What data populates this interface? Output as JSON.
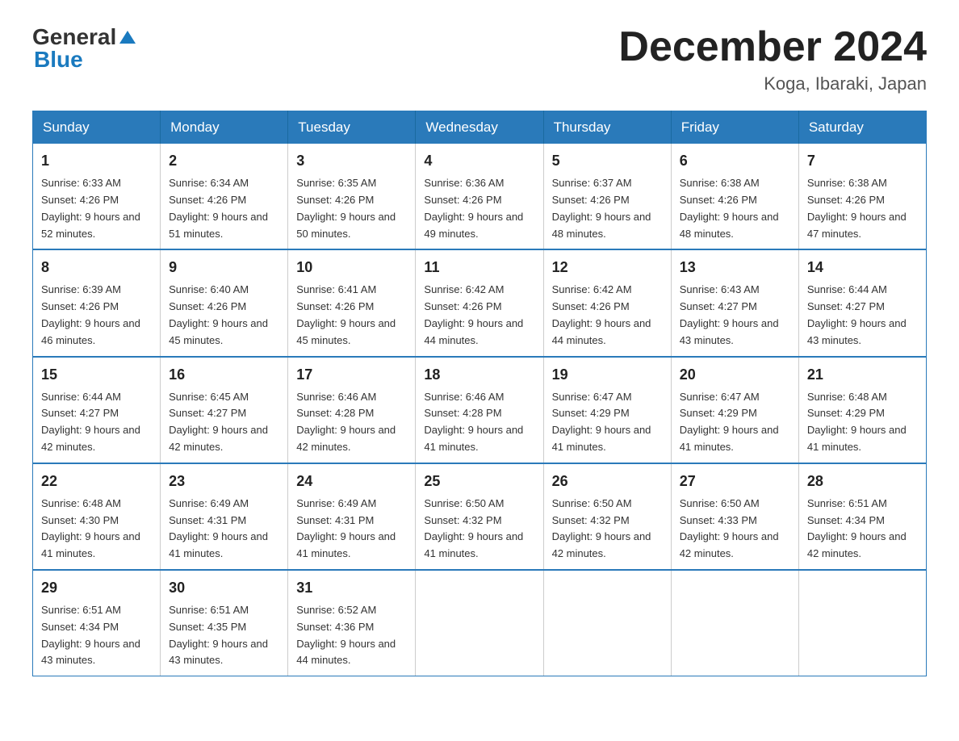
{
  "header": {
    "logo_text1": "General",
    "logo_text2": "Blue",
    "month_title": "December 2024",
    "location": "Koga, Ibaraki, Japan"
  },
  "days_of_week": [
    "Sunday",
    "Monday",
    "Tuesday",
    "Wednesday",
    "Thursday",
    "Friday",
    "Saturday"
  ],
  "weeks": [
    [
      {
        "day": "1",
        "sunrise": "6:33 AM",
        "sunset": "4:26 PM",
        "daylight": "9 hours and 52 minutes."
      },
      {
        "day": "2",
        "sunrise": "6:34 AM",
        "sunset": "4:26 PM",
        "daylight": "9 hours and 51 minutes."
      },
      {
        "day": "3",
        "sunrise": "6:35 AM",
        "sunset": "4:26 PM",
        "daylight": "9 hours and 50 minutes."
      },
      {
        "day": "4",
        "sunrise": "6:36 AM",
        "sunset": "4:26 PM",
        "daylight": "9 hours and 49 minutes."
      },
      {
        "day": "5",
        "sunrise": "6:37 AM",
        "sunset": "4:26 PM",
        "daylight": "9 hours and 48 minutes."
      },
      {
        "day": "6",
        "sunrise": "6:38 AM",
        "sunset": "4:26 PM",
        "daylight": "9 hours and 48 minutes."
      },
      {
        "day": "7",
        "sunrise": "6:38 AM",
        "sunset": "4:26 PM",
        "daylight": "9 hours and 47 minutes."
      }
    ],
    [
      {
        "day": "8",
        "sunrise": "6:39 AM",
        "sunset": "4:26 PM",
        "daylight": "9 hours and 46 minutes."
      },
      {
        "day": "9",
        "sunrise": "6:40 AM",
        "sunset": "4:26 PM",
        "daylight": "9 hours and 45 minutes."
      },
      {
        "day": "10",
        "sunrise": "6:41 AM",
        "sunset": "4:26 PM",
        "daylight": "9 hours and 45 minutes."
      },
      {
        "day": "11",
        "sunrise": "6:42 AM",
        "sunset": "4:26 PM",
        "daylight": "9 hours and 44 minutes."
      },
      {
        "day": "12",
        "sunrise": "6:42 AM",
        "sunset": "4:26 PM",
        "daylight": "9 hours and 44 minutes."
      },
      {
        "day": "13",
        "sunrise": "6:43 AM",
        "sunset": "4:27 PM",
        "daylight": "9 hours and 43 minutes."
      },
      {
        "day": "14",
        "sunrise": "6:44 AM",
        "sunset": "4:27 PM",
        "daylight": "9 hours and 43 minutes."
      }
    ],
    [
      {
        "day": "15",
        "sunrise": "6:44 AM",
        "sunset": "4:27 PM",
        "daylight": "9 hours and 42 minutes."
      },
      {
        "day": "16",
        "sunrise": "6:45 AM",
        "sunset": "4:27 PM",
        "daylight": "9 hours and 42 minutes."
      },
      {
        "day": "17",
        "sunrise": "6:46 AM",
        "sunset": "4:28 PM",
        "daylight": "9 hours and 42 minutes."
      },
      {
        "day": "18",
        "sunrise": "6:46 AM",
        "sunset": "4:28 PM",
        "daylight": "9 hours and 41 minutes."
      },
      {
        "day": "19",
        "sunrise": "6:47 AM",
        "sunset": "4:29 PM",
        "daylight": "9 hours and 41 minutes."
      },
      {
        "day": "20",
        "sunrise": "6:47 AM",
        "sunset": "4:29 PM",
        "daylight": "9 hours and 41 minutes."
      },
      {
        "day": "21",
        "sunrise": "6:48 AM",
        "sunset": "4:29 PM",
        "daylight": "9 hours and 41 minutes."
      }
    ],
    [
      {
        "day": "22",
        "sunrise": "6:48 AM",
        "sunset": "4:30 PM",
        "daylight": "9 hours and 41 minutes."
      },
      {
        "day": "23",
        "sunrise": "6:49 AM",
        "sunset": "4:31 PM",
        "daylight": "9 hours and 41 minutes."
      },
      {
        "day": "24",
        "sunrise": "6:49 AM",
        "sunset": "4:31 PM",
        "daylight": "9 hours and 41 minutes."
      },
      {
        "day": "25",
        "sunrise": "6:50 AM",
        "sunset": "4:32 PM",
        "daylight": "9 hours and 41 minutes."
      },
      {
        "day": "26",
        "sunrise": "6:50 AM",
        "sunset": "4:32 PM",
        "daylight": "9 hours and 42 minutes."
      },
      {
        "day": "27",
        "sunrise": "6:50 AM",
        "sunset": "4:33 PM",
        "daylight": "9 hours and 42 minutes."
      },
      {
        "day": "28",
        "sunrise": "6:51 AM",
        "sunset": "4:34 PM",
        "daylight": "9 hours and 42 minutes."
      }
    ],
    [
      {
        "day": "29",
        "sunrise": "6:51 AM",
        "sunset": "4:34 PM",
        "daylight": "9 hours and 43 minutes."
      },
      {
        "day": "30",
        "sunrise": "6:51 AM",
        "sunset": "4:35 PM",
        "daylight": "9 hours and 43 minutes."
      },
      {
        "day": "31",
        "sunrise": "6:52 AM",
        "sunset": "4:36 PM",
        "daylight": "9 hours and 44 minutes."
      },
      null,
      null,
      null,
      null
    ]
  ]
}
